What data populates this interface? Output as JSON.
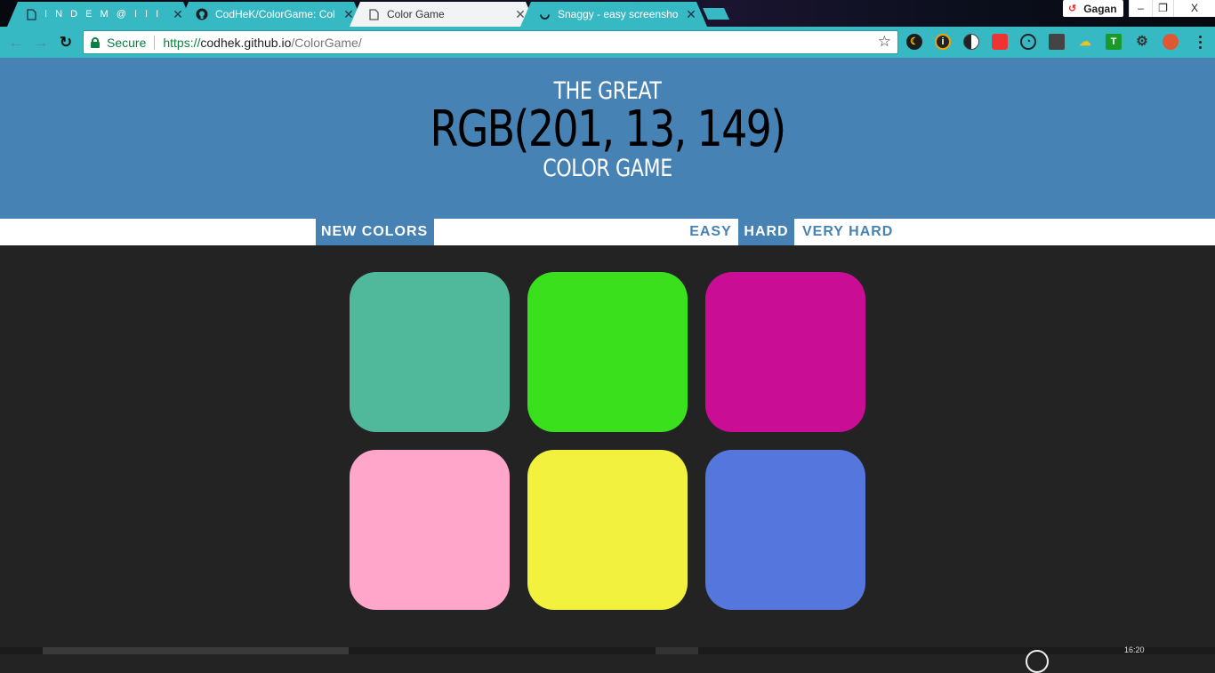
{
  "browser": {
    "tabs": [
      {
        "title": "I N D E M @ I I I T A",
        "icon": "document-icon",
        "active": false
      },
      {
        "title": "CodHeK/ColorGame: Col",
        "icon": "github-icon",
        "active": false
      },
      {
        "title": "Color Game",
        "icon": "document-icon",
        "active": true
      },
      {
        "title": "Snaggy - easy screensho",
        "icon": "loading-spinner-icon",
        "active": false
      }
    ],
    "profile_name": "Gagan",
    "window_controls": {
      "minimize": "–",
      "restore": "❐",
      "close": "X"
    },
    "address": {
      "security_label": "Secure",
      "scheme": "https://",
      "host": "codhek.github.io",
      "path": "/ColorGame/"
    }
  },
  "game": {
    "title_top": "The Great",
    "target_color": "RGB(201, 13, 149)",
    "title_bottom": "Color Game",
    "buttons": {
      "new_colors": "New Colors",
      "easy": "Easy",
      "hard": "Hard",
      "very_hard": "Very Hard"
    },
    "selected_mode": "hard",
    "header_color": "#4682b4",
    "squares": [
      {
        "color": "#51b99b"
      },
      {
        "color": "#3ae01c"
      },
      {
        "color": "#c90d95"
      },
      {
        "color": "#ffa6ca"
      },
      {
        "color": "#f2f23e"
      },
      {
        "color": "#5577dd"
      }
    ]
  },
  "taskbar": {
    "clock": "16:20"
  }
}
